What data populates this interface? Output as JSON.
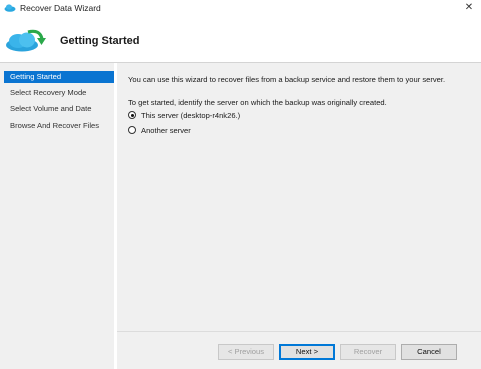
{
  "window": {
    "title": "Recover Data Wizard",
    "close_glyph": "✕"
  },
  "header": {
    "title": "Getting Started",
    "icon": "cloud-recover-icon"
  },
  "sidebar": {
    "items": [
      {
        "label": "Getting Started",
        "active": true
      },
      {
        "label": "Select Recovery Mode",
        "active": false
      },
      {
        "label": "Select Volume and Date",
        "active": false
      },
      {
        "label": "Browse And Recover Files",
        "active": false
      }
    ]
  },
  "main": {
    "intro": "You can use this wizard to recover files from a backup service and restore them to your server.",
    "instruction": "To get started, identify the server on which the backup was originally created.",
    "options": [
      {
        "label": "This server (desktop-r4nk26.)",
        "selected": true
      },
      {
        "label": "Another server",
        "selected": false
      }
    ]
  },
  "buttons": {
    "previous": "< Previous",
    "next": "Next >",
    "recover": "Recover",
    "cancel": "Cancel"
  },
  "colors": {
    "accent": "#0a74d1",
    "cloud": "#29a8e0",
    "arrow": "#2aa84a"
  }
}
